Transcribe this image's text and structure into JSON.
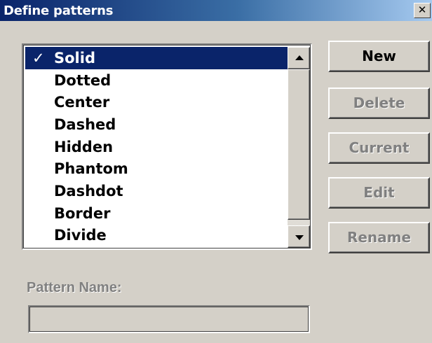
{
  "window": {
    "title": "Define patterns",
    "close_glyph": "✕"
  },
  "list": {
    "check_glyph": "✓",
    "items": [
      {
        "label": "Solid",
        "selected": true
      },
      {
        "label": "Dotted"
      },
      {
        "label": "Center"
      },
      {
        "label": "Dashed"
      },
      {
        "label": "Hidden"
      },
      {
        "label": "Phantom"
      },
      {
        "label": "Dashdot"
      },
      {
        "label": "Border"
      },
      {
        "label": "Divide"
      }
    ]
  },
  "buttons": {
    "new": "New",
    "delete": "Delete",
    "current": "Current",
    "edit": "Edit",
    "rename": "Rename"
  },
  "pattern_name": {
    "label": "Pattern Name:",
    "value": ""
  },
  "colors": {
    "selection": "#0a246a",
    "disabled_text": "#808080",
    "face": "#d4d0c8"
  }
}
